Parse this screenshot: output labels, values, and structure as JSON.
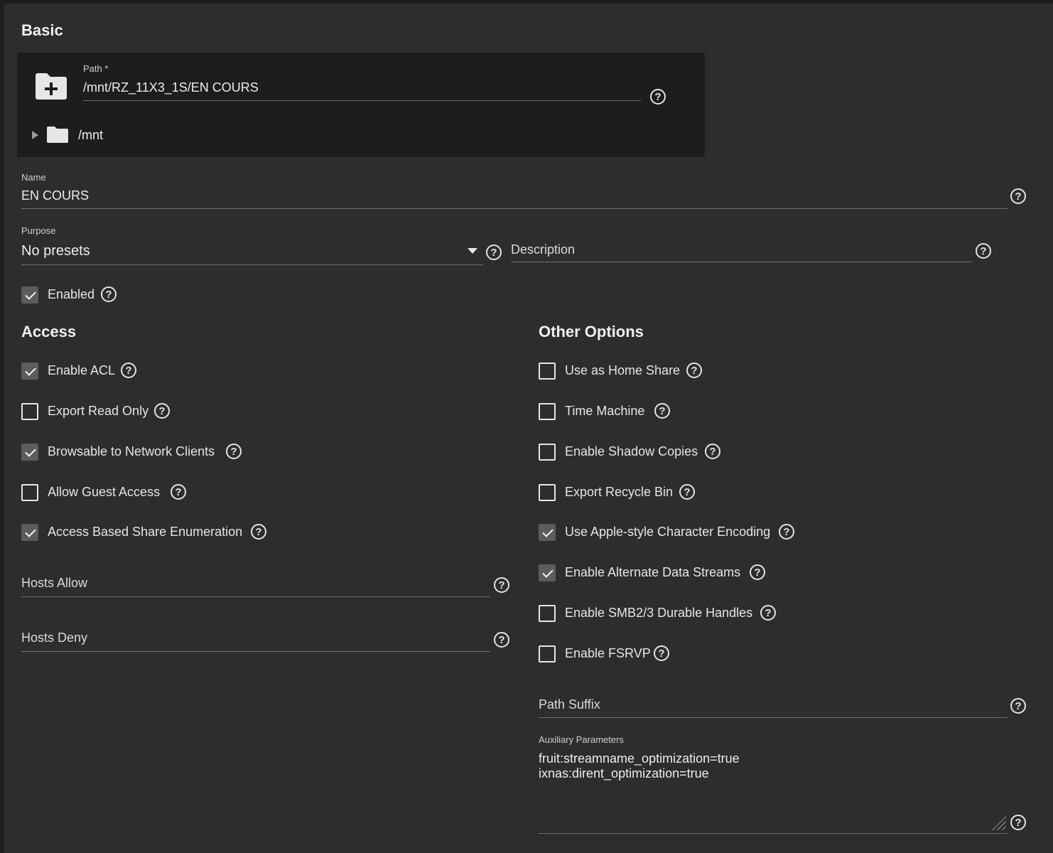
{
  "basic": {
    "title": "Basic",
    "path": {
      "label": "Path *",
      "value": "/mnt/RZ_11X3_1S/EN COURS",
      "tree_root": "/mnt"
    },
    "name": {
      "label": "Name",
      "value": "EN COURS"
    },
    "purpose": {
      "label": "Purpose",
      "value": "No presets"
    },
    "description": {
      "placeholder": "Description",
      "value": ""
    },
    "enabled": {
      "label": "Enabled",
      "checked": true
    }
  },
  "access": {
    "title": "Access",
    "options": [
      {
        "label": "Enable ACL",
        "checked": true
      },
      {
        "label": "Export Read Only",
        "checked": false
      },
      {
        "label": "Browsable to Network Clients",
        "checked": true
      },
      {
        "label": "Allow Guest Access",
        "checked": false
      },
      {
        "label": "Access Based Share Enumeration",
        "checked": true
      }
    ],
    "hosts_allow": {
      "placeholder": "Hosts Allow"
    },
    "hosts_deny": {
      "placeholder": "Hosts Deny"
    }
  },
  "other": {
    "title": "Other Options",
    "options": [
      {
        "label": "Use as Home Share",
        "checked": false
      },
      {
        "label": "Time Machine",
        "checked": false
      },
      {
        "label": "Enable Shadow Copies",
        "checked": false
      },
      {
        "label": "Export Recycle Bin",
        "checked": false
      },
      {
        "label": "Use Apple-style Character Encoding",
        "checked": true
      },
      {
        "label": "Enable Alternate Data Streams",
        "checked": true
      },
      {
        "label": "Enable SMB2/3 Durable Handles",
        "checked": false
      },
      {
        "label": "Enable FSRVP",
        "checked": false
      }
    ],
    "path_suffix": {
      "placeholder": "Path Suffix"
    },
    "aux": {
      "label": "Auxiliary Parameters",
      "value": "fruit:streamname_optimization=true\nixnas:dirent_optimization=true"
    }
  },
  "icons": {
    "help": "help-circle-icon",
    "folder_add": "folder-plus-icon",
    "folder": "folder-icon"
  },
  "colors": {
    "background": "#2d2d2d",
    "path_box": "#1d1d1d",
    "checked_box": "#5c5c5c"
  }
}
